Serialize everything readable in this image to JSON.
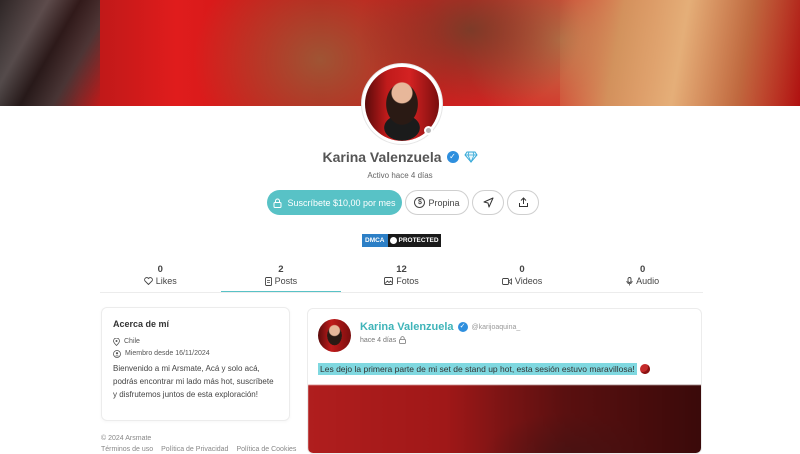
{
  "profile": {
    "name": "Karina Valenzuela",
    "status": "Activo hace 4 días"
  },
  "actions": {
    "subscribe_label": "Suscríbete $10,00 por mes",
    "tip_label": "Propina",
    "tip_symbol": "$"
  },
  "dmca": {
    "left": "DMCA",
    "right": "PROTECTED"
  },
  "tabs": [
    {
      "count": "0",
      "label": "Likes",
      "icon": "heart-icon"
    },
    {
      "count": "2",
      "label": "Posts",
      "icon": "document-icon"
    },
    {
      "count": "12",
      "label": "Fotos",
      "icon": "image-icon"
    },
    {
      "count": "0",
      "label": "Videos",
      "icon": "video-icon"
    },
    {
      "count": "0",
      "label": "Audio",
      "icon": "microphone-icon"
    }
  ],
  "active_tab_index": 1,
  "about": {
    "title": "Acerca de mí",
    "location": "Chile",
    "member_since": "Miembro desde 16/11/2024",
    "bio": "Bienvenido a mi Arsmate, Acá y solo acá, podrás encontrar mi lado más hot, suscríbete y disfrutemos juntos de esta exploración!"
  },
  "footer": {
    "copyright": "© 2024 Arsmate",
    "links": [
      "Términos de uso",
      "Política de Privacidad",
      "Política de Cookies"
    ]
  },
  "post": {
    "author": "Karina Valenzuela",
    "handle": "@karijoaquina_",
    "time": "hace 4 días",
    "text": "Les dejo la primera parte de mi set de stand up hot, esta sesión estuvo maravillosa!"
  },
  "colors": {
    "accent": "#58c2c6",
    "accent_text": "#3fb4b9",
    "verified": "#2e8fde",
    "highlight": "#7fd8e0"
  }
}
